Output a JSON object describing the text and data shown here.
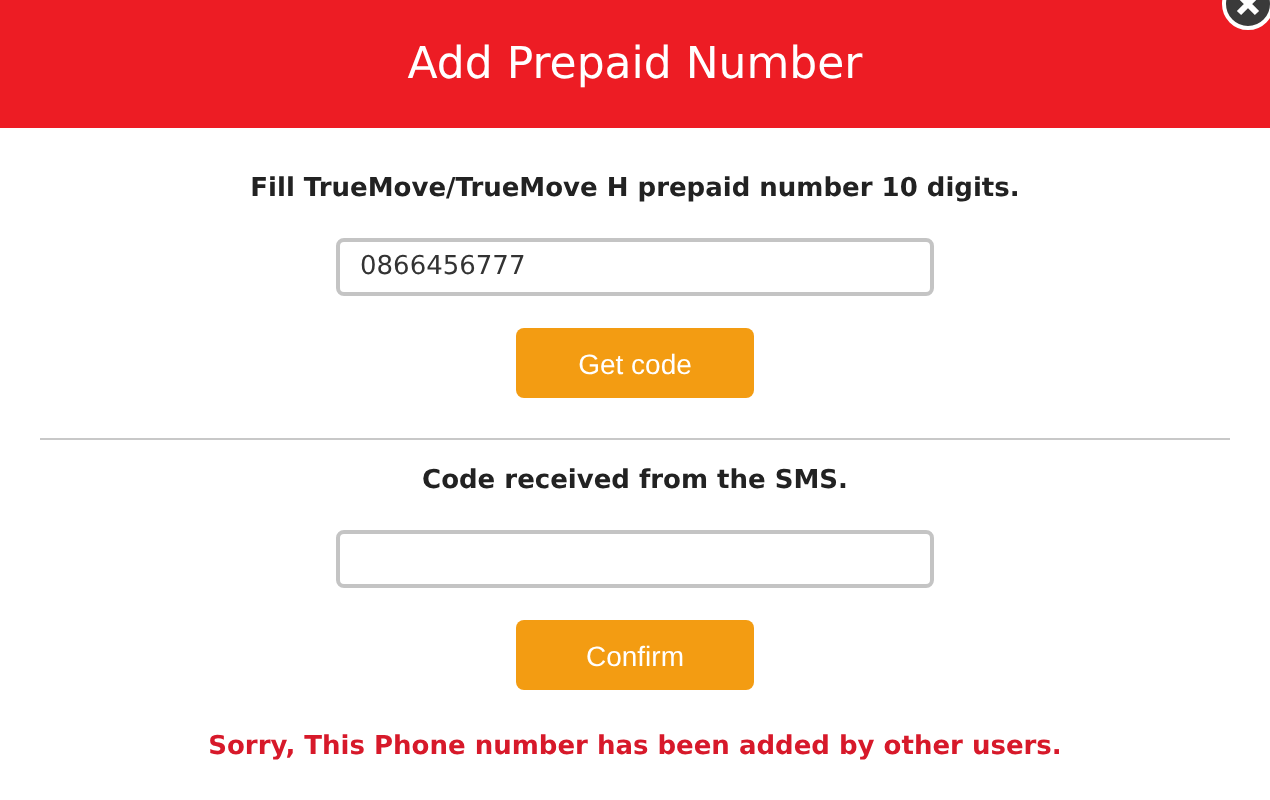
{
  "dialog": {
    "title": "Add Prepaid Number",
    "phone_section": {
      "label": "Fill TrueMove/TrueMove H prepaid number 10 digits.",
      "value": "0866456777",
      "button": "Get code"
    },
    "code_section": {
      "label": "Code received from the SMS.",
      "button": "Confirm"
    },
    "error": "Sorry, This Phone number has been added by other users."
  }
}
